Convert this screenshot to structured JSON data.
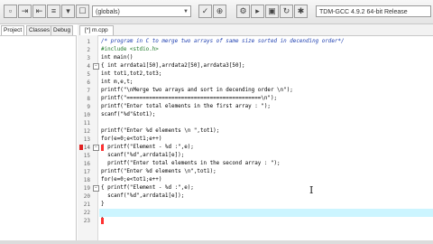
{
  "toolbar": {
    "scope_combo": "(globals)",
    "compiler_combo": "TDM-GCC 4.9.2 64-bit Release"
  },
  "left_panel": {
    "tabs": [
      "Project",
      "Classes",
      "Debug"
    ]
  },
  "editor": {
    "tab_label": "[*] m.cpp",
    "line_numbers": [
      "1",
      "2",
      "3",
      "4",
      "5",
      "6",
      "7",
      "8",
      "9",
      "10",
      "11",
      "12",
      "13",
      "14",
      "15",
      "16",
      "17",
      "18",
      "19",
      "20",
      "21",
      "22",
      "23"
    ],
    "lines": [
      "/* program in C to merge two arrays of same size sorted in decending order*/",
      "#include <stdio.h>",
      "int main()",
      "{ int arrdata1[50],arrdata2[50],arrdata3[50];",
      "int tot1,tot2,tot3;",
      "int m,e,t;",
      "printf(\"\\nMerge two arrays and sort in decending order \\n\");",
      "printf(\"==========================================\\n\");",
      "printf(\"Enter total elements in the first array : \");",
      "scanf(\"%d\"&tot1);",
      "",
      "printf(\"Enter %d elements \\n \",tot1);",
      "for(e=0;e<tot1;e++)",
      "{ printf(\"Element - %d :\",e);",
      "  scanf(\"%d\",arrdata1[e]);",
      "  printf(\"Enter total elements in the second array : \");",
      "printf(\"Enter %d elements \\n\",tot1);",
      "for(e=0;e<tot1;e++)",
      "{ printf(\"Element - %d :\",e);",
      "  scanf(\"%d\",arrdata1[e]);",
      "}",
      "",
      "}"
    ]
  },
  "icons": {
    "cursor": "ibeam-cursor-icon"
  }
}
